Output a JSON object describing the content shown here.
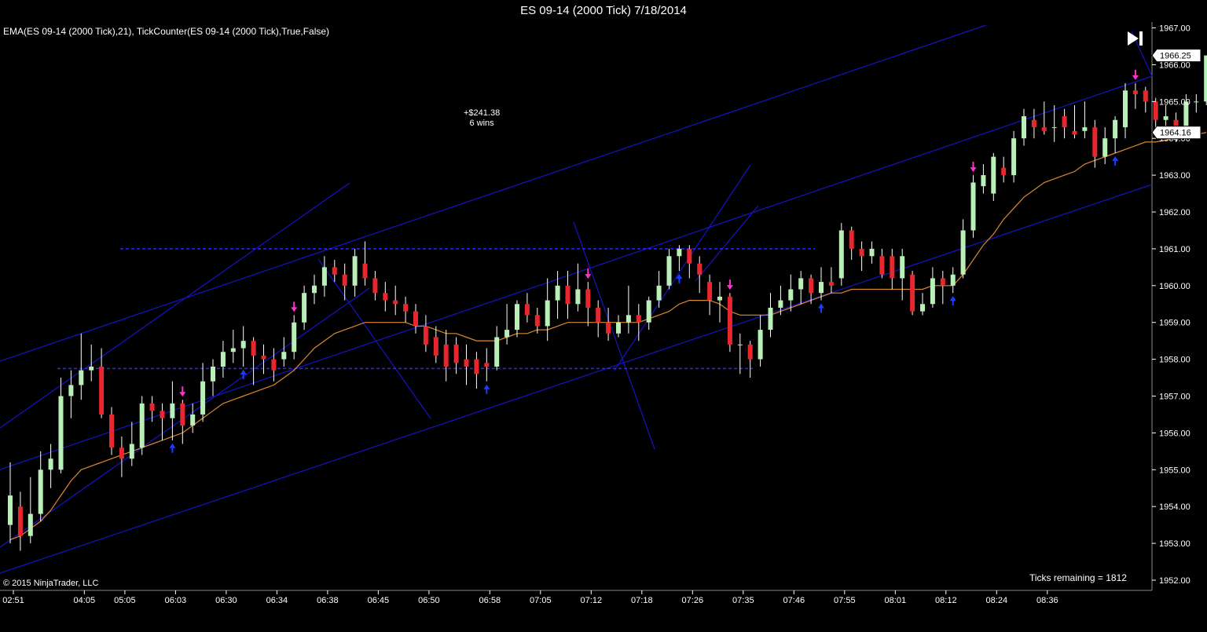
{
  "header": {
    "title": "ES 09-14 (2000 Tick)  7/18/2014",
    "indicators": "EMA(ES 09-14 (2000 Tick),21),  TickCounter(ES 09-14 (2000 Tick),True,False)"
  },
  "annotation": {
    "pnl": "+$241.38",
    "wins": "6 wins"
  },
  "footer": {
    "copyright": "© 2015 NinjaTrader, LLC",
    "ticks_remaining": "Ticks remaining = 1812"
  },
  "price_markers": {
    "last": "1966.25",
    "ema": "1964.16"
  },
  "colors": {
    "up": "#b8f0b8",
    "down": "#e8262e",
    "ema": "#d9892e",
    "trendline": "#1414c8",
    "signal_up": "#1a3cff",
    "signal_down": "#ff33cc"
  },
  "chart_data": {
    "type": "candlestick",
    "ylim": [
      1952.0,
      1967.0
    ],
    "yticks": [
      "1967.00",
      "1966.00",
      "1965.00",
      "1964.00",
      "1963.00",
      "1962.00",
      "1961.00",
      "1960.00",
      "1959.00",
      "1958.00",
      "1957.00",
      "1956.00",
      "1955.00",
      "1954.00",
      "1953.00",
      "1952.00"
    ],
    "xticks": [
      "02:51",
      "04:05",
      "05:05",
      "06:03",
      "06:30",
      "06:34",
      "06:38",
      "06:45",
      "06:50",
      "06:58",
      "07:05",
      "07:12",
      "07:18",
      "07:26",
      "07:35",
      "07:46",
      "07:55",
      "08:01",
      "08:12",
      "08:24",
      "08:36"
    ],
    "xtick_bars": [
      0,
      7,
      11,
      16,
      21,
      26,
      31,
      36,
      41,
      47,
      52,
      57,
      62,
      67,
      72,
      77,
      82,
      87,
      92,
      97,
      102
    ],
    "ema_value_last": 1964.16,
    "last_price": 1966.25,
    "candles": [
      [
        1953.5,
        1954.3,
        1955.2,
        1953.0
      ],
      [
        1954.0,
        1953.2,
        1954.4,
        1952.8
      ],
      [
        1953.2,
        1953.8,
        1954.8,
        1953.0
      ],
      [
        1953.8,
        1955.0,
        1955.5,
        1953.6
      ],
      [
        1955.0,
        1955.3,
        1955.7,
        1954.5
      ],
      [
        1955.0,
        1957.0,
        1957.5,
        1954.9
      ],
      [
        1957.0,
        1957.3,
        1957.7,
        1956.4
      ],
      [
        1957.3,
        1957.7,
        1958.7,
        1956.9
      ],
      [
        1957.7,
        1957.8,
        1958.4,
        1957.4
      ],
      [
        1957.8,
        1956.5,
        1958.3,
        1956.4
      ],
      [
        1956.5,
        1955.6,
        1956.7,
        1955.4
      ],
      [
        1955.6,
        1955.3,
        1955.9,
        1954.8
      ],
      [
        1955.3,
        1955.7,
        1956.3,
        1955.1
      ],
      [
        1955.6,
        1956.8,
        1957.0,
        1955.4
      ],
      [
        1956.8,
        1956.6,
        1957.0,
        1956.3
      ],
      [
        1956.6,
        1956.4,
        1956.8,
        1955.8
      ],
      [
        1956.4,
        1956.8,
        1957.4,
        1955.8
      ],
      [
        1956.8,
        1956.2,
        1956.9,
        1955.7
      ],
      [
        1956.2,
        1956.5,
        1956.8,
        1956.0
      ],
      [
        1956.5,
        1957.4,
        1957.9,
        1956.3
      ],
      [
        1957.4,
        1957.8,
        1958.0,
        1957.0
      ],
      [
        1957.8,
        1958.2,
        1958.5,
        1957.5
      ],
      [
        1958.2,
        1958.3,
        1958.8,
        1957.9
      ],
      [
        1958.3,
        1958.5,
        1958.9,
        1957.8
      ],
      [
        1958.5,
        1958.1,
        1958.6,
        1957.3
      ],
      [
        1958.1,
        1958.0,
        1958.4,
        1957.6
      ],
      [
        1958.0,
        1957.7,
        1958.3,
        1957.4
      ],
      [
        1958.0,
        1958.2,
        1958.6,
        1957.8
      ],
      [
        1958.2,
        1959.0,
        1959.2,
        1958.0
      ],
      [
        1959.0,
        1959.8,
        1960.0,
        1958.8
      ],
      [
        1959.8,
        1960.0,
        1960.3,
        1959.5
      ],
      [
        1960.0,
        1960.5,
        1960.8,
        1959.7
      ],
      [
        1960.5,
        1960.3,
        1960.7,
        1960.1
      ],
      [
        1960.3,
        1960.0,
        1960.6,
        1959.6
      ],
      [
        1960.0,
        1960.8,
        1961.0,
        1959.7
      ],
      [
        1960.6,
        1960.2,
        1961.2,
        1960.0
      ],
      [
        1960.2,
        1959.8,
        1960.4,
        1959.6
      ],
      [
        1959.8,
        1959.6,
        1960.1,
        1959.3
      ],
      [
        1959.6,
        1959.5,
        1960.0,
        1959.2
      ],
      [
        1959.5,
        1959.3,
        1959.7,
        1959.0
      ],
      [
        1959.3,
        1958.9,
        1959.5,
        1958.7
      ],
      [
        1958.9,
        1958.4,
        1959.2,
        1958.2
      ],
      [
        1958.6,
        1958.1,
        1958.9,
        1957.9
      ],
      [
        1958.4,
        1957.8,
        1958.8,
        1957.4
      ],
      [
        1958.4,
        1957.9,
        1958.6,
        1957.6
      ],
      [
        1958.0,
        1957.8,
        1958.4,
        1957.3
      ],
      [
        1958.0,
        1957.6,
        1958.2,
        1957.2
      ],
      [
        1957.9,
        1957.8,
        1958.3,
        1957.4
      ],
      [
        1957.8,
        1958.6,
        1958.9,
        1957.7
      ],
      [
        1958.6,
        1958.8,
        1959.5,
        1958.4
      ],
      [
        1958.8,
        1959.5,
        1959.6,
        1958.6
      ],
      [
        1959.5,
        1959.2,
        1959.8,
        1959.0
      ],
      [
        1959.2,
        1958.9,
        1959.4,
        1958.7
      ],
      [
        1958.9,
        1959.6,
        1960.2,
        1958.5
      ],
      [
        1959.6,
        1960.0,
        1960.4,
        1959.1
      ],
      [
        1960.0,
        1959.5,
        1960.4,
        1959.1
      ],
      [
        1959.5,
        1959.9,
        1960.6,
        1959.3
      ],
      [
        1959.9,
        1959.4,
        1960.1,
        1958.9
      ],
      [
        1959.4,
        1959.0,
        1959.6,
        1958.6
      ],
      [
        1959.0,
        1958.7,
        1959.4,
        1958.5
      ],
      [
        1958.7,
        1959.0,
        1959.2,
        1958.6
      ],
      [
        1959.0,
        1959.2,
        1960.0,
        1958.7
      ],
      [
        1959.2,
        1959.0,
        1959.5,
        1958.5
      ],
      [
        1959.0,
        1959.6,
        1959.7,
        1958.8
      ],
      [
        1959.6,
        1960.0,
        1960.4,
        1959.4
      ],
      [
        1960.0,
        1960.8,
        1961.0,
        1959.9
      ],
      [
        1960.8,
        1961.0,
        1961.1,
        1960.4
      ],
      [
        1961.0,
        1960.6,
        1961.1,
        1960.2
      ],
      [
        1960.6,
        1960.3,
        1960.8,
        1959.8
      ],
      [
        1960.1,
        1959.6,
        1960.3,
        1959.2
      ],
      [
        1959.6,
        1959.7,
        1960.1,
        1959.0
      ],
      [
        1959.7,
        1958.4,
        1959.8,
        1958.2
      ],
      [
        1958.4,
        1958.4,
        1958.7,
        1957.6
      ],
      [
        1958.4,
        1958.0,
        1958.5,
        1957.5
      ],
      [
        1958.0,
        1958.8,
        1959.2,
        1957.8
      ],
      [
        1958.8,
        1959.4,
        1959.8,
        1958.6
      ],
      [
        1959.4,
        1959.6,
        1960.0,
        1959.2
      ],
      [
        1959.6,
        1959.9,
        1960.3,
        1959.3
      ],
      [
        1959.9,
        1960.2,
        1960.4,
        1959.5
      ],
      [
        1960.2,
        1959.8,
        1960.3,
        1959.5
      ],
      [
        1959.8,
        1960.1,
        1960.5,
        1959.6
      ],
      [
        1960.1,
        1960.0,
        1960.5,
        1959.8
      ],
      [
        1960.2,
        1961.5,
        1961.7,
        1960.0
      ],
      [
        1961.5,
        1961.0,
        1961.6,
        1960.7
      ],
      [
        1961.0,
        1960.8,
        1961.2,
        1960.4
      ],
      [
        1960.8,
        1961.0,
        1961.2,
        1960.6
      ],
      [
        1960.8,
        1960.3,
        1961.0,
        1960.2
      ],
      [
        1960.8,
        1960.2,
        1961.0,
        1959.9
      ],
      [
        1960.2,
        1960.8,
        1961.0,
        1959.6
      ],
      [
        1960.3,
        1959.3,
        1960.4,
        1959.2
      ],
      [
        1959.3,
        1959.5,
        1959.8,
        1959.2
      ],
      [
        1959.5,
        1960.2,
        1960.5,
        1959.4
      ],
      [
        1960.2,
        1960.0,
        1960.4,
        1959.5
      ],
      [
        1960.0,
        1960.3,
        1960.5,
        1959.8
      ],
      [
        1960.3,
        1961.5,
        1961.8,
        1960.2
      ],
      [
        1961.5,
        1962.8,
        1963.0,
        1961.3
      ],
      [
        1962.7,
        1963.0,
        1963.3,
        1962.5
      ],
      [
        1962.5,
        1963.5,
        1963.6,
        1962.3
      ],
      [
        1963.2,
        1963.0,
        1963.5,
        1962.8
      ],
      [
        1963.0,
        1964.0,
        1964.2,
        1962.8
      ],
      [
        1964.0,
        1964.6,
        1964.8,
        1963.8
      ],
      [
        1964.5,
        1964.3,
        1964.8,
        1964.0
      ],
      [
        1964.3,
        1964.2,
        1965.0,
        1964.1
      ],
      [
        1964.3,
        1964.3,
        1964.9,
        1963.9
      ],
      [
        1964.6,
        1964.3,
        1964.8,
        1964.0
      ],
      [
        1964.2,
        1964.1,
        1964.9,
        1964.0
      ],
      [
        1964.2,
        1964.3,
        1965.0,
        1964.0
      ],
      [
        1964.3,
        1963.5,
        1964.5,
        1963.2
      ],
      [
        1963.5,
        1964.0,
        1964.3,
        1963.3
      ],
      [
        1964.0,
        1964.5,
        1964.6,
        1963.6
      ],
      [
        1964.3,
        1965.3,
        1965.5,
        1964.0
      ],
      [
        1965.3,
        1965.2,
        1965.5,
        1964.8
      ],
      [
        1965.3,
        1965.0,
        1965.4,
        1964.7
      ],
      [
        1965.0,
        1964.5,
        1965.1,
        1964.2
      ],
      [
        1964.5,
        1964.6,
        1964.9,
        1964.0
      ],
      [
        1964.5,
        1964.3,
        1964.7,
        1963.9
      ],
      [
        1964.3,
        1965.0,
        1965.2,
        1964.2
      ],
      [
        1965.0,
        1965.0,
        1965.2,
        1964.7
      ],
      [
        1965.0,
        1966.25,
        1966.25,
        1964.9
      ]
    ],
    "ema": [
      1953.1,
      1953.2,
      1953.4,
      1953.6,
      1953.9,
      1954.3,
      1954.7,
      1955.0,
      1955.1,
      1955.2,
      1955.3,
      1955.4,
      1955.5,
      1955.6,
      1955.7,
      1955.8,
      1955.9,
      1956.0,
      1956.2,
      1956.4,
      1956.6,
      1956.8,
      1956.9,
      1957.0,
      1957.1,
      1957.2,
      1957.3,
      1957.5,
      1957.7,
      1958.0,
      1958.3,
      1958.5,
      1958.7,
      1958.8,
      1958.9,
      1959.0,
      1959.0,
      1959.0,
      1959.0,
      1959.0,
      1958.9,
      1958.9,
      1958.8,
      1958.7,
      1958.7,
      1958.6,
      1958.5,
      1958.5,
      1958.5,
      1958.6,
      1958.7,
      1958.7,
      1958.8,
      1958.8,
      1958.9,
      1959.0,
      1959.0,
      1959.0,
      1959.0,
      1959.0,
      1959.0,
      1959.0,
      1959.0,
      1959.1,
      1959.2,
      1959.3,
      1959.5,
      1959.6,
      1959.6,
      1959.6,
      1959.5,
      1959.3,
      1959.2,
      1959.2,
      1959.2,
      1959.2,
      1959.3,
      1959.4,
      1959.5,
      1959.6,
      1959.7,
      1959.8,
      1959.8,
      1959.9,
      1959.9,
      1959.9,
      1959.9,
      1959.9,
      1959.9,
      1959.9,
      1959.9,
      1960.0,
      1960.0,
      1960.0,
      1960.3,
      1960.7,
      1961.1,
      1961.4,
      1961.8,
      1962.1,
      1962.4,
      1962.6,
      1962.8,
      1962.9,
      1963.0,
      1963.1,
      1963.3,
      1963.4,
      1963.5,
      1963.6,
      1963.7,
      1963.8,
      1963.9,
      1963.9,
      1963.95,
      1964.0,
      1964.05,
      1964.1,
      1964.16
    ],
    "signals": [
      {
        "bar": 16,
        "dir": "up"
      },
      {
        "bar": 17,
        "dir": "down"
      },
      {
        "bar": 23,
        "dir": "up"
      },
      {
        "bar": 28,
        "dir": "down"
      },
      {
        "bar": 47,
        "dir": "up"
      },
      {
        "bar": 57,
        "dir": "down"
      },
      {
        "bar": 66,
        "dir": "up"
      },
      {
        "bar": 71,
        "dir": "down"
      },
      {
        "bar": 80,
        "dir": "up"
      },
      {
        "bar": 93,
        "dir": "up"
      },
      {
        "bar": 95,
        "dir": "down"
      },
      {
        "bar": 109,
        "dir": "up"
      },
      {
        "bar": 111,
        "dir": "down"
      }
    ]
  }
}
